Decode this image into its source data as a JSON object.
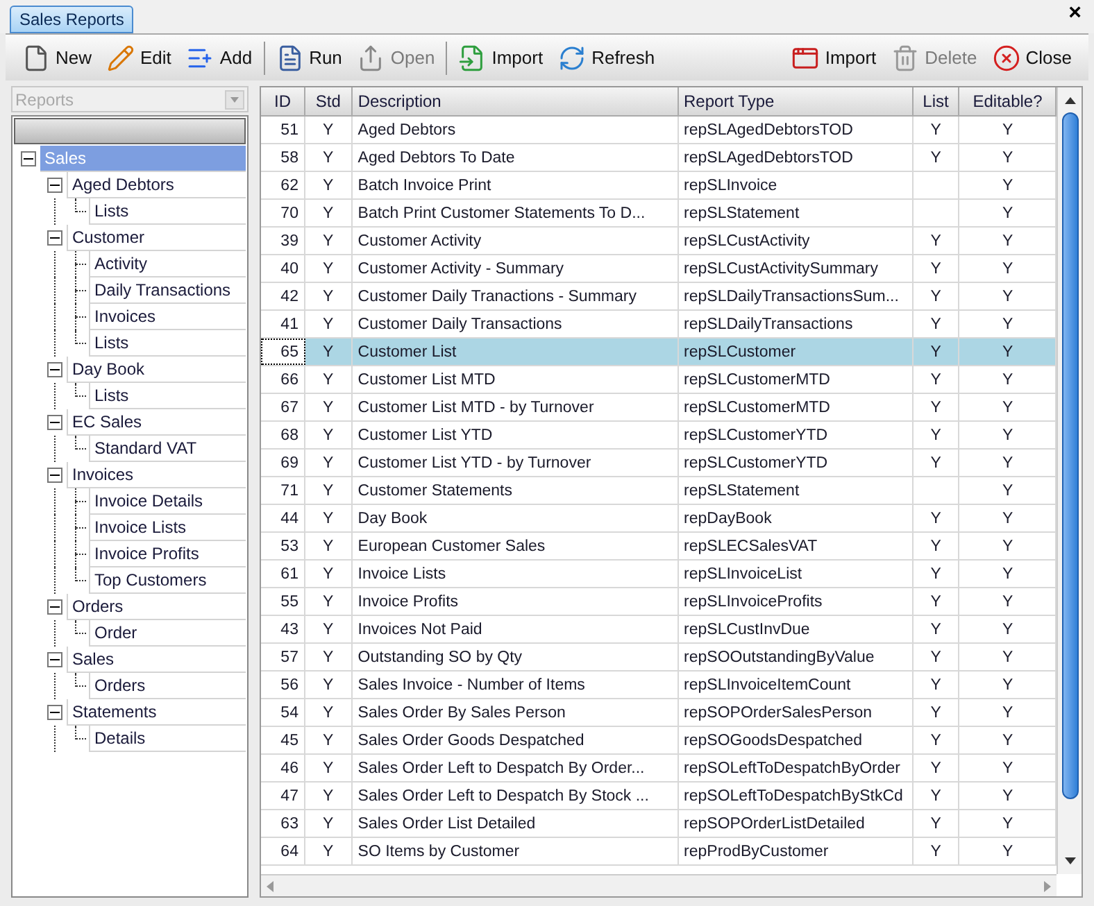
{
  "tab": {
    "label": "Sales Reports",
    "selected": true
  },
  "close_glyph": "×",
  "toolbar": {
    "groups": [
      {
        "buttons": [
          {
            "label": "New",
            "disabled": false
          },
          {
            "label": "Edit",
            "disabled": false
          },
          {
            "label": "Add",
            "disabled": false
          }
        ]
      },
      {
        "buttons": [
          {
            "label": "Run",
            "disabled": false
          },
          {
            "label": "Open",
            "disabled": true
          }
        ]
      },
      {
        "buttons": [
          {
            "label": "Import",
            "disabled": false
          },
          {
            "label": "Refresh",
            "disabled": false
          }
        ]
      },
      {
        "buttons": [
          {
            "label": "Import",
            "disabled": false
          },
          {
            "label": "Delete",
            "disabled": true
          },
          {
            "label": "Close",
            "disabled": false
          }
        ]
      }
    ]
  },
  "sidebar": {
    "dropdown": {
      "placeholder": "Reports",
      "disabled": true
    },
    "tree": [
      {
        "label": "Sales",
        "selected": true,
        "expanded": true,
        "children": [
          {
            "label": "Aged Debtors",
            "selected": false,
            "expanded": true,
            "children": [
              {
                "label": "Lists",
                "selected": false
              }
            ]
          },
          {
            "label": "Customer",
            "selected": false,
            "expanded": true,
            "children": [
              {
                "label": "Activity",
                "selected": false
              },
              {
                "label": "Daily Transactions",
                "selected": false
              },
              {
                "label": "Invoices",
                "selected": false
              },
              {
                "label": "Lists",
                "selected": false
              }
            ]
          },
          {
            "label": "Day Book",
            "selected": false,
            "expanded": true,
            "children": [
              {
                "label": "Lists",
                "selected": false
              }
            ]
          },
          {
            "label": "EC Sales",
            "selected": false,
            "expanded": true,
            "children": [
              {
                "label": "Standard VAT",
                "selected": false
              }
            ]
          },
          {
            "label": "Invoices",
            "selected": false,
            "expanded": true,
            "children": [
              {
                "label": "Invoice Details",
                "selected": false
              },
              {
                "label": "Invoice Lists",
                "selected": false
              },
              {
                "label": "Invoice Profits",
                "selected": false
              },
              {
                "label": "Top Customers",
                "selected": false
              }
            ]
          },
          {
            "label": "Orders",
            "selected": false,
            "expanded": true,
            "children": [
              {
                "label": "Order",
                "selected": false
              }
            ]
          },
          {
            "label": "Sales",
            "selected": false,
            "expanded": true,
            "children": [
              {
                "label": "Orders",
                "selected": false
              }
            ]
          },
          {
            "label": "Statements",
            "selected": false,
            "expanded": true,
            "children": [
              {
                "label": "Details",
                "selected": false
              }
            ]
          }
        ]
      }
    ]
  },
  "table": {
    "columns": [
      "ID",
      "Std",
      "Description",
      "Report Type",
      "List",
      "Editable?"
    ],
    "rows": [
      {
        "cells": [
          "51",
          "Y",
          "Aged Debtors",
          "repSLAgedDebtorsTOD",
          "Y",
          "Y"
        ],
        "selected": false
      },
      {
        "cells": [
          "58",
          "Y",
          "Aged Debtors To Date",
          "repSLAgedDebtorsTOD",
          "Y",
          "Y"
        ],
        "selected": false
      },
      {
        "cells": [
          "62",
          "Y",
          "Batch Invoice Print",
          "repSLInvoice",
          "",
          "Y"
        ],
        "selected": false
      },
      {
        "cells": [
          "70",
          "Y",
          "Batch Print Customer Statements To D...",
          "repSLStatement",
          "",
          "Y"
        ],
        "selected": false
      },
      {
        "cells": [
          "39",
          "Y",
          "Customer Activity",
          "repSLCustActivity",
          "Y",
          "Y"
        ],
        "selected": false
      },
      {
        "cells": [
          "40",
          "Y",
          "Customer Activity - Summary",
          "repSLCustActivitySummary",
          "Y",
          "Y"
        ],
        "selected": false
      },
      {
        "cells": [
          "42",
          "Y",
          "Customer Daily Tranactions - Summary",
          "repSLDailyTransactionsSum...",
          "Y",
          "Y"
        ],
        "selected": false
      },
      {
        "cells": [
          "41",
          "Y",
          "Customer Daily Transactions",
          "repSLDailyTransactions",
          "Y",
          "Y"
        ],
        "selected": false
      },
      {
        "cells": [
          "65",
          "Y",
          "Customer List",
          "repSLCustomer",
          "Y",
          "Y"
        ],
        "selected": true
      },
      {
        "cells": [
          "66",
          "Y",
          "Customer List MTD",
          "repSLCustomerMTD",
          "Y",
          "Y"
        ],
        "selected": false
      },
      {
        "cells": [
          "67",
          "Y",
          "Customer List MTD - by Turnover",
          "repSLCustomerMTD",
          "Y",
          "Y"
        ],
        "selected": false
      },
      {
        "cells": [
          "68",
          "Y",
          "Customer List YTD",
          "repSLCustomerYTD",
          "Y",
          "Y"
        ],
        "selected": false
      },
      {
        "cells": [
          "69",
          "Y",
          "Customer List YTD - by Turnover",
          "repSLCustomerYTD",
          "Y",
          "Y"
        ],
        "selected": false
      },
      {
        "cells": [
          "71",
          "Y",
          "Customer Statements",
          "repSLStatement",
          "",
          "Y"
        ],
        "selected": false
      },
      {
        "cells": [
          "44",
          "Y",
          "Day Book",
          "repDayBook",
          "Y",
          "Y"
        ],
        "selected": false
      },
      {
        "cells": [
          "53",
          "Y",
          "European Customer Sales",
          "repSLECSalesVAT",
          "Y",
          "Y"
        ],
        "selected": false
      },
      {
        "cells": [
          "61",
          "Y",
          "Invoice Lists",
          "repSLInvoiceList",
          "Y",
          "Y"
        ],
        "selected": false
      },
      {
        "cells": [
          "55",
          "Y",
          "Invoice Profits",
          "repSLInvoiceProfits",
          "Y",
          "Y"
        ],
        "selected": false
      },
      {
        "cells": [
          "43",
          "Y",
          "Invoices Not Paid",
          "repSLCustInvDue",
          "Y",
          "Y"
        ],
        "selected": false
      },
      {
        "cells": [
          "57",
          "Y",
          "Outstanding SO by Qty",
          "repSOOutstandingByValue",
          "Y",
          "Y"
        ],
        "selected": false
      },
      {
        "cells": [
          "56",
          "Y",
          "Sales Invoice - Number of Items",
          "repSLInvoiceItemCount",
          "Y",
          "Y"
        ],
        "selected": false
      },
      {
        "cells": [
          "54",
          "Y",
          "Sales Order By Sales Person",
          "repSOPOrderSalesPerson",
          "Y",
          "Y"
        ],
        "selected": false
      },
      {
        "cells": [
          "45",
          "Y",
          "Sales Order Goods Despatched",
          "repSOGoodsDespatched",
          "Y",
          "Y"
        ],
        "selected": false
      },
      {
        "cells": [
          "46",
          "Y",
          "Sales Order Left to Despatch By Order...",
          "repSOLeftToDespatchByOrder",
          "Y",
          "Y"
        ],
        "selected": false
      },
      {
        "cells": [
          "47",
          "Y",
          "Sales Order Left to Despatch By Stock ...",
          "repSOLeftToDespatchByStkCd",
          "Y",
          "Y"
        ],
        "selected": false
      },
      {
        "cells": [
          "63",
          "Y",
          "Sales Order List Detailed",
          "repSOPOrderListDetailed",
          "Y",
          "Y"
        ],
        "selected": false
      },
      {
        "cells": [
          "64",
          "Y",
          "SO Items by Customer",
          "repProdByCustomer",
          "Y",
          "Y"
        ],
        "selected": false
      }
    ]
  }
}
